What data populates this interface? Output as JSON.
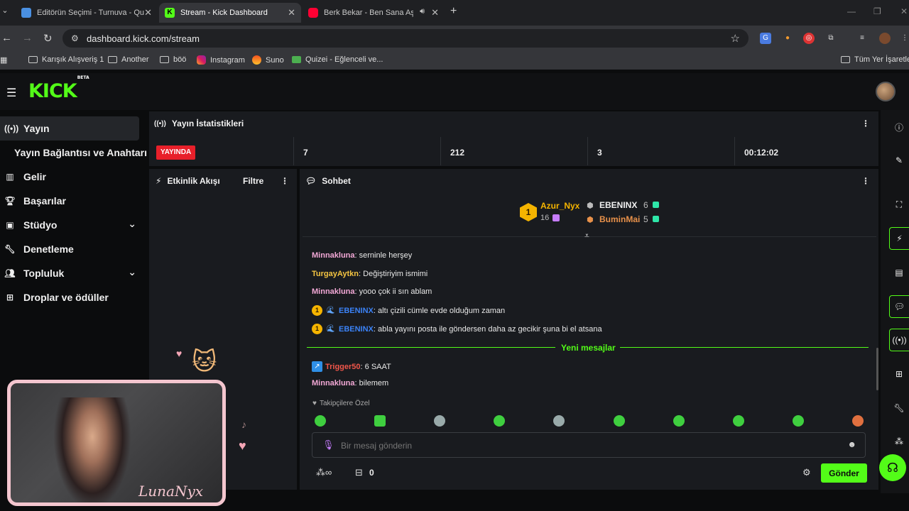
{
  "browser": {
    "tabs": [
      {
        "title": "Editörün Seçimi - Turnuva - Qu",
        "favicon_color": "#4a90e2"
      },
      {
        "title": "Stream - Kick Dashboard",
        "favicon_color": "#53fc18"
      },
      {
        "title": "Berk Bekar - Ben Sana Aşık",
        "favicon_color": "#ff0033"
      }
    ],
    "url": "dashboard.kick.com/stream",
    "bookmarks": [
      {
        "label": "Karışık Alışveriş 1",
        "icon": "folder-icon"
      },
      {
        "label": "Another",
        "icon": "folder-icon"
      },
      {
        "label": "böö",
        "icon": "folder-icon"
      },
      {
        "label": "Instagram",
        "icon": "instagram-icon"
      },
      {
        "label": "Suno",
        "icon": "suno-icon"
      },
      {
        "label": "Quizei - Eğlenceli ve...",
        "icon": "quizei-icon"
      }
    ],
    "all_bookmarks_label": "Tüm Yer İşaretleri"
  },
  "app": {
    "logo": "KICK",
    "logo_beta": "BETA",
    "sidebar": [
      {
        "label": "Yayın",
        "icon": "broadcast-icon",
        "active": true
      },
      {
        "label": "Yayın Bağlantısı ve Anahtarı",
        "sub": true
      },
      {
        "label": "Gelir",
        "icon": "chart-icon"
      },
      {
        "label": "Başarılar",
        "icon": "trophy-icon"
      },
      {
        "label": "Stüdyo",
        "icon": "studio-icon",
        "expandable": true
      },
      {
        "label": "Denetleme",
        "icon": "wrench-icon"
      },
      {
        "label": "Topluluk",
        "icon": "community-icon",
        "expandable": true
      },
      {
        "label": "Droplar ve ödüller",
        "icon": "gift-icon"
      }
    ],
    "stats": {
      "title": "Yayın İstatistikleri",
      "live_label": "YAYINDA",
      "values": [
        "7",
        "212",
        "3",
        "00:12:02"
      ]
    },
    "activity": {
      "title": "Etkinlik Akışı",
      "filter_label": "Filtre"
    },
    "chat": {
      "title": "Sohbet",
      "leaderboard": {
        "top": {
          "name": "Azur_Nyx",
          "count": "16",
          "rank": "1"
        },
        "second": {
          "name": "EBENINX",
          "count": "6"
        },
        "third": {
          "name": "BuminMai",
          "count": "5"
        }
      },
      "messages": [
        {
          "user": "Minnakluna",
          "text": ": serninle herşey",
          "color": "#f2a8d6"
        },
        {
          "user": "TurgayAytkn",
          "text": ": Değiştiriyim ismimi",
          "color": "#f5c542"
        },
        {
          "user": "Minnakluna",
          "text": ": yooo çok ii sın ablam",
          "color": "#f2a8d6"
        },
        {
          "user": "EBENINX",
          "text": ": altı çizili cümle evde olduğum zaman",
          "color": "#3b82f6",
          "badge": "1"
        },
        {
          "user": "EBENINX",
          "text": ": abla yayını posta ile göndersen daha az gecikir şuna bi el atsana",
          "color": "#3b82f6",
          "badge": "1"
        },
        {
          "user": "Trigger50",
          "text": ": 6 SAAT",
          "color": "#f0564a"
        },
        {
          "user": "Minnakluna",
          "text": ": bilemem",
          "color": "#f2a8d6"
        }
      ],
      "new_messages_label": "Yeni mesajlar",
      "followers_only_label": "Takipçilere Özel",
      "input_placeholder": "Bir mesaj gönderin",
      "points_value": "0",
      "send_label": "Gönder"
    },
    "webcam_label": "LunaNyx"
  },
  "colors": {
    "accent": "#53fc18",
    "live": "#e8202a",
    "panel": "#191b1f"
  }
}
